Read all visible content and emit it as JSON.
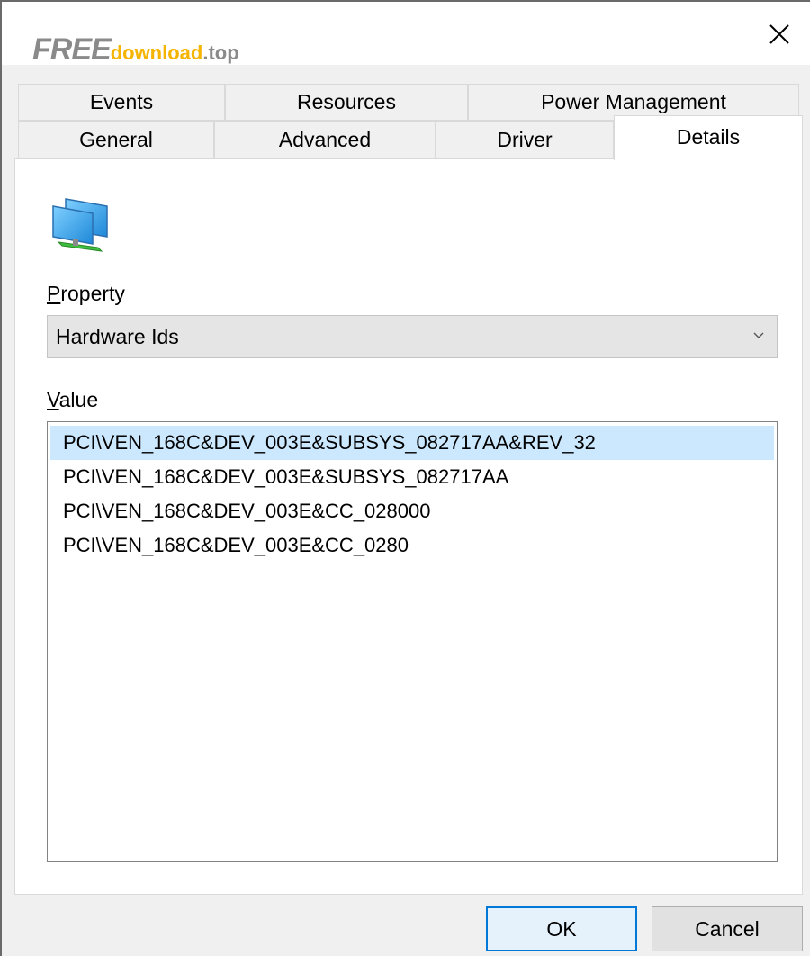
{
  "watermark": {
    "free": "FREE",
    "download": "download",
    "tld": ".top"
  },
  "window": {
    "close_icon": "close-icon"
  },
  "tabs": {
    "row_back": [
      {
        "label": "Events"
      },
      {
        "label": "Resources"
      },
      {
        "label": "Power Management"
      }
    ],
    "row_front": [
      {
        "label": "General"
      },
      {
        "label": "Advanced"
      },
      {
        "label": "Driver"
      },
      {
        "label": "Details"
      }
    ],
    "active": "Details"
  },
  "details": {
    "device_icon": "network-adapter-icon",
    "property_label_accel": "P",
    "property_label_rest": "roperty",
    "property_value": "Hardware Ids",
    "value_label_accel": "V",
    "value_label_rest": "alue",
    "values": [
      "PCI\\VEN_168C&DEV_003E&SUBSYS_082717AA&REV_32",
      "PCI\\VEN_168C&DEV_003E&SUBSYS_082717AA",
      "PCI\\VEN_168C&DEV_003E&CC_028000",
      "PCI\\VEN_168C&DEV_003E&CC_0280"
    ],
    "selected_index": 0
  },
  "buttons": {
    "ok": "OK",
    "cancel": "Cancel"
  },
  "colors": {
    "selection": "#cce8ff",
    "default_button_border": "#0078d7",
    "logo_accent": "#f5b400"
  }
}
